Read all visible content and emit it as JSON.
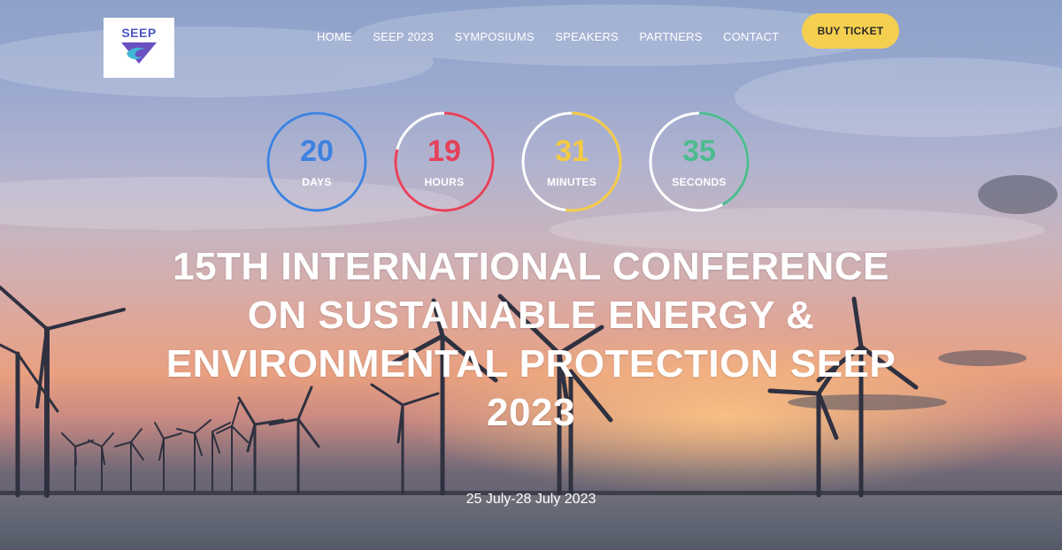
{
  "header": {
    "logo_text": "SEEP",
    "nav": [
      "HOME",
      "SEEP 2023",
      "SYMPOSIUMS",
      "SPEAKERS",
      "PARTNERS",
      "CONTACT"
    ],
    "buy_label": "BUY TICKET"
  },
  "countdown": [
    {
      "value": "20",
      "label": "DAYS",
      "color": "#3d82e0",
      "fraction": 1.0
    },
    {
      "value": "19",
      "label": "HOURS",
      "color": "#e6415b",
      "fraction": 0.79
    },
    {
      "value": "31",
      "label": "MINUTES",
      "color": "#f3ca45",
      "fraction": 0.52
    },
    {
      "value": "35",
      "label": "SECONDS",
      "color": "#4dbb8f",
      "fraction": 0.42
    }
  ],
  "hero": {
    "title_lines": [
      "15TH INTERNATIONAL CONFERENCE",
      "ON SUSTAINABLE ENERGY &",
      "ENVIRONMENTAL PROTECTION SEEP",
      "2023"
    ],
    "dates": "25 July-28 July 2023"
  }
}
